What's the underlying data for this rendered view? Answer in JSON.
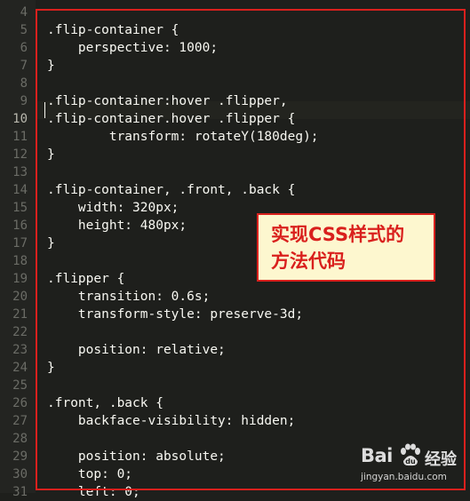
{
  "editor": {
    "lines": [
      {
        "num": "4",
        "text": ""
      },
      {
        "num": "5",
        "text": ".flip-container {"
      },
      {
        "num": "6",
        "text": "    perspective: 1000;"
      },
      {
        "num": "7",
        "text": "}"
      },
      {
        "num": "8",
        "text": ""
      },
      {
        "num": "9",
        "text": ".flip-container:hover .flipper,"
      },
      {
        "num": "10",
        "text": ".flip-container.hover .flipper {"
      },
      {
        "num": "11",
        "text": "        transform: rotateY(180deg);"
      },
      {
        "num": "12",
        "text": "}"
      },
      {
        "num": "13",
        "text": ""
      },
      {
        "num": "14",
        "text": ".flip-container, .front, .back {"
      },
      {
        "num": "15",
        "text": "    width: 320px;"
      },
      {
        "num": "16",
        "text": "    height: 480px;"
      },
      {
        "num": "17",
        "text": "}"
      },
      {
        "num": "18",
        "text": ""
      },
      {
        "num": "19",
        "text": ".flipper {"
      },
      {
        "num": "20",
        "text": "    transition: 0.6s;"
      },
      {
        "num": "21",
        "text": "    transform-style: preserve-3d;"
      },
      {
        "num": "22",
        "text": ""
      },
      {
        "num": "23",
        "text": "    position: relative;"
      },
      {
        "num": "24",
        "text": "}"
      },
      {
        "num": "25",
        "text": ""
      },
      {
        "num": "26",
        "text": ".front, .back {"
      },
      {
        "num": "27",
        "text": "    backface-visibility: hidden;"
      },
      {
        "num": "28",
        "text": ""
      },
      {
        "num": "29",
        "text": "    position: absolute;"
      },
      {
        "num": "30",
        "text": "    top: 0;"
      },
      {
        "num": "31",
        "text": "    left: 0;"
      }
    ],
    "current_line": "10"
  },
  "annotation": {
    "line1": "实现CSS样式的",
    "line2": "方法代码"
  },
  "watermark": {
    "brand": "Bai",
    "suffix": "经验",
    "url": "jingyan.baidu.com"
  },
  "colors": {
    "background": "#1e1f1c",
    "text": "#f8f8f2",
    "line_number": "#6b6c66",
    "highlight_red": "#d9201d",
    "annotation_bg": "#fdf7cf"
  }
}
